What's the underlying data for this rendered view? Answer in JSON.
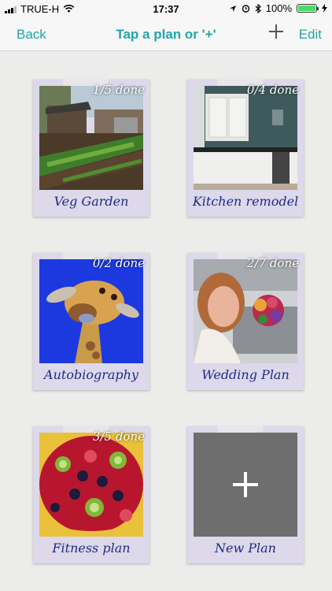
{
  "status": {
    "carrier": "TRUE-H",
    "time": "17:37",
    "battery": "100%"
  },
  "nav": {
    "back_label": "Back",
    "title": "Tap a plan or '+'",
    "edit_label": "Edit",
    "add_icon": "plus-icon"
  },
  "plans": [
    {
      "name": "Veg Garden",
      "progress": "1/5 done"
    },
    {
      "name": "Kitchen remodel",
      "progress": "0/4 done"
    },
    {
      "name": "Autobiography",
      "progress": "0/2 done"
    },
    {
      "name": "Wedding Plan",
      "progress": "2/7 done"
    },
    {
      "name": "Fitness plan",
      "progress": "3/5 done"
    }
  ],
  "new_plan": {
    "name": "New Plan",
    "icon": "plus-icon"
  },
  "colors": {
    "accent": "#1fa6a8",
    "label": "#1e2a8a"
  }
}
